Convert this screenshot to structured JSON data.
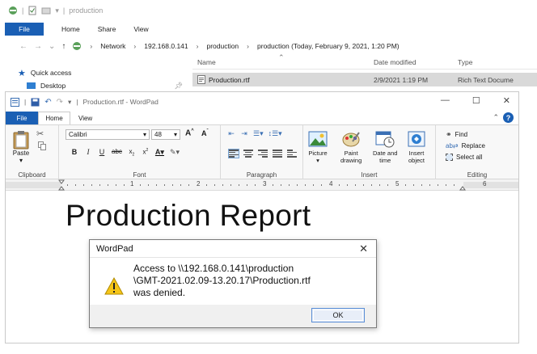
{
  "explorer": {
    "title": "production",
    "tabs": [
      "File",
      "Home",
      "Share",
      "View"
    ],
    "breadcrumb": [
      "Network",
      "192.168.0.141",
      "production",
      "production (Today, February 9, 2021, 1:20 PM)"
    ],
    "columns": {
      "name": "Name",
      "date": "Date modified",
      "type": "Type"
    },
    "sidebar": [
      {
        "label": "Quick access",
        "icon": "star-icon"
      },
      {
        "label": "Desktop",
        "icon": "desktop-icon"
      }
    ],
    "file": {
      "name": "Production.rtf",
      "date": "2/9/2021 1:19 PM",
      "type": "Rich Text Docume"
    }
  },
  "wordpad": {
    "title": "Production.rtf - WordPad",
    "tabs": {
      "file": "File",
      "home": "Home",
      "view": "View"
    },
    "ribbon": {
      "clipboard": {
        "paste": "Paste",
        "label": "Clipboard"
      },
      "font": {
        "family": "Calibri",
        "size": "48",
        "label": "Font"
      },
      "paragraph": {
        "label": "Paragraph"
      },
      "insert": {
        "label": "Insert",
        "picture": "Picture",
        "paint1": "Paint",
        "paint2": "drawing",
        "date1": "Date and",
        "date2": "time",
        "object1": "Insert",
        "object2": "object"
      },
      "editing": {
        "label": "Editing",
        "find": "Find",
        "replace": "Replace",
        "select_all": "Select all"
      }
    },
    "ruler_numbers": [
      "1",
      "2",
      "3",
      "4",
      "5",
      "6"
    ],
    "document_heading": "Production Report"
  },
  "dialog": {
    "title": "WordPad",
    "line1": "Access to \\\\192.168.0.141\\production",
    "line2": "\\GMT-2021.02.09-13.20.17\\Production.rtf",
    "line3": "was denied.",
    "ok": "OK"
  },
  "colors": {
    "accent": "#1a5fb4",
    "warning": "#f5c518"
  }
}
